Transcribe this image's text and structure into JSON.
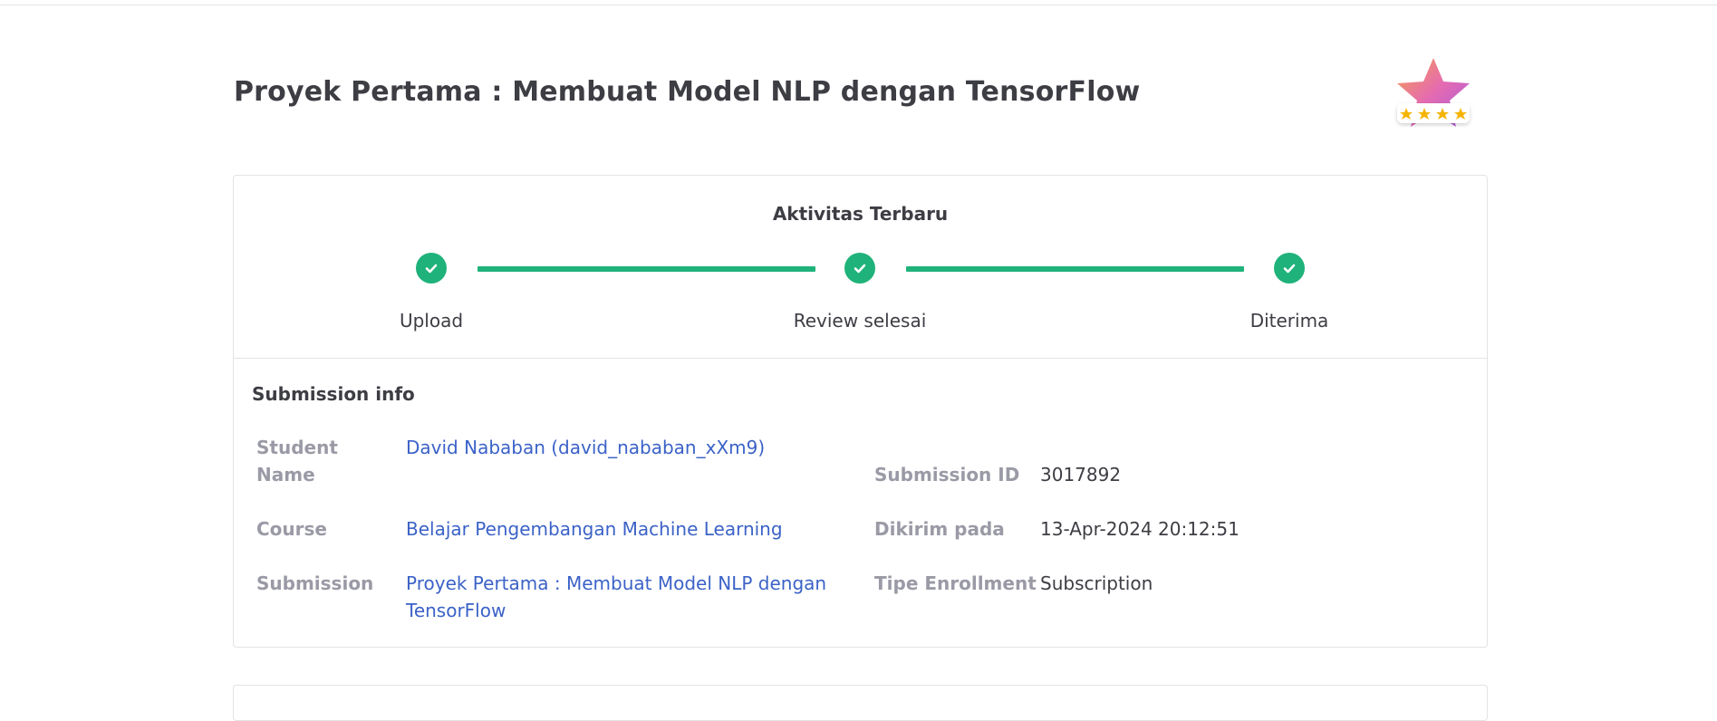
{
  "page": {
    "title": "Proyek Pertama : Membuat Model NLP dengan TensorFlow"
  },
  "badge": {
    "icon": "star-rating-badge-icon",
    "rating": 4,
    "max_rating": 4
  },
  "activity": {
    "title": "Aktivitas Terbaru",
    "steps": [
      {
        "label": "Upload",
        "status": "done"
      },
      {
        "label": "Review selesai",
        "status": "done"
      },
      {
        "label": "Diterima",
        "status": "done"
      }
    ],
    "accent_color": "#1fb27a"
  },
  "submission_info": {
    "title": "Submission info",
    "student_name_label": "Student Name",
    "student_name_value": "David Nababan (david_nababan_xXm9)",
    "course_label": "Course",
    "course_value": "Belajar Pengembangan Machine Learning",
    "submission_label": "Submission",
    "submission_value": "Proyek Pertama : Membuat Model NLP dengan TensorFlow",
    "submission_id_label": "Submission ID",
    "submission_id_value": "3017892",
    "sent_at_label": "Dikirim pada",
    "sent_at_value": "13-Apr-2024 20:12:51",
    "enrollment_type_label": "Tipe Enrollment",
    "enrollment_type_value": "Subscription",
    "link_color": "#3b62c7"
  }
}
